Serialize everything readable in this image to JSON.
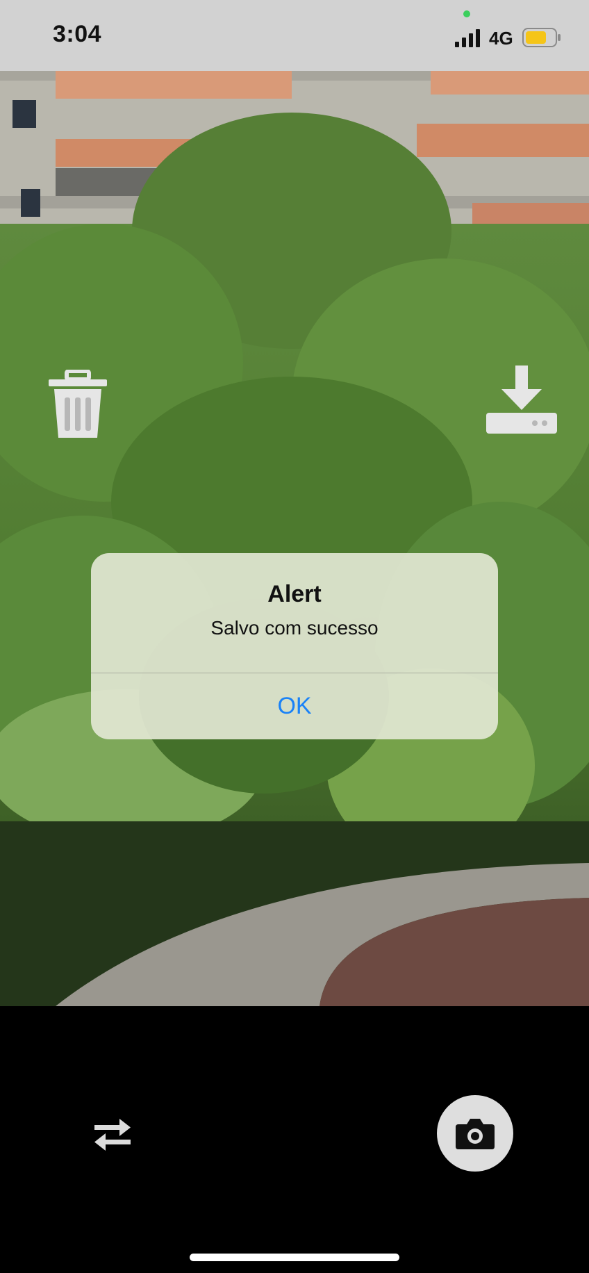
{
  "status_bar": {
    "time": "3:04",
    "network": "4G",
    "icons": [
      "signal-icon",
      "battery-icon"
    ],
    "battery_color": "#f5c518",
    "privacy_indicator_color": "#3bcf5c"
  },
  "toolbar": {
    "delete_icon": "trash-icon",
    "save_icon": "download-icon"
  },
  "alert": {
    "title": "Alert",
    "message": "Salvo com sucesso",
    "ok_label": "OK",
    "button_color": "#1a82f7"
  },
  "camera_controls": {
    "switch_icon": "switch-camera-icon",
    "shutter_icon": "camera-icon"
  }
}
